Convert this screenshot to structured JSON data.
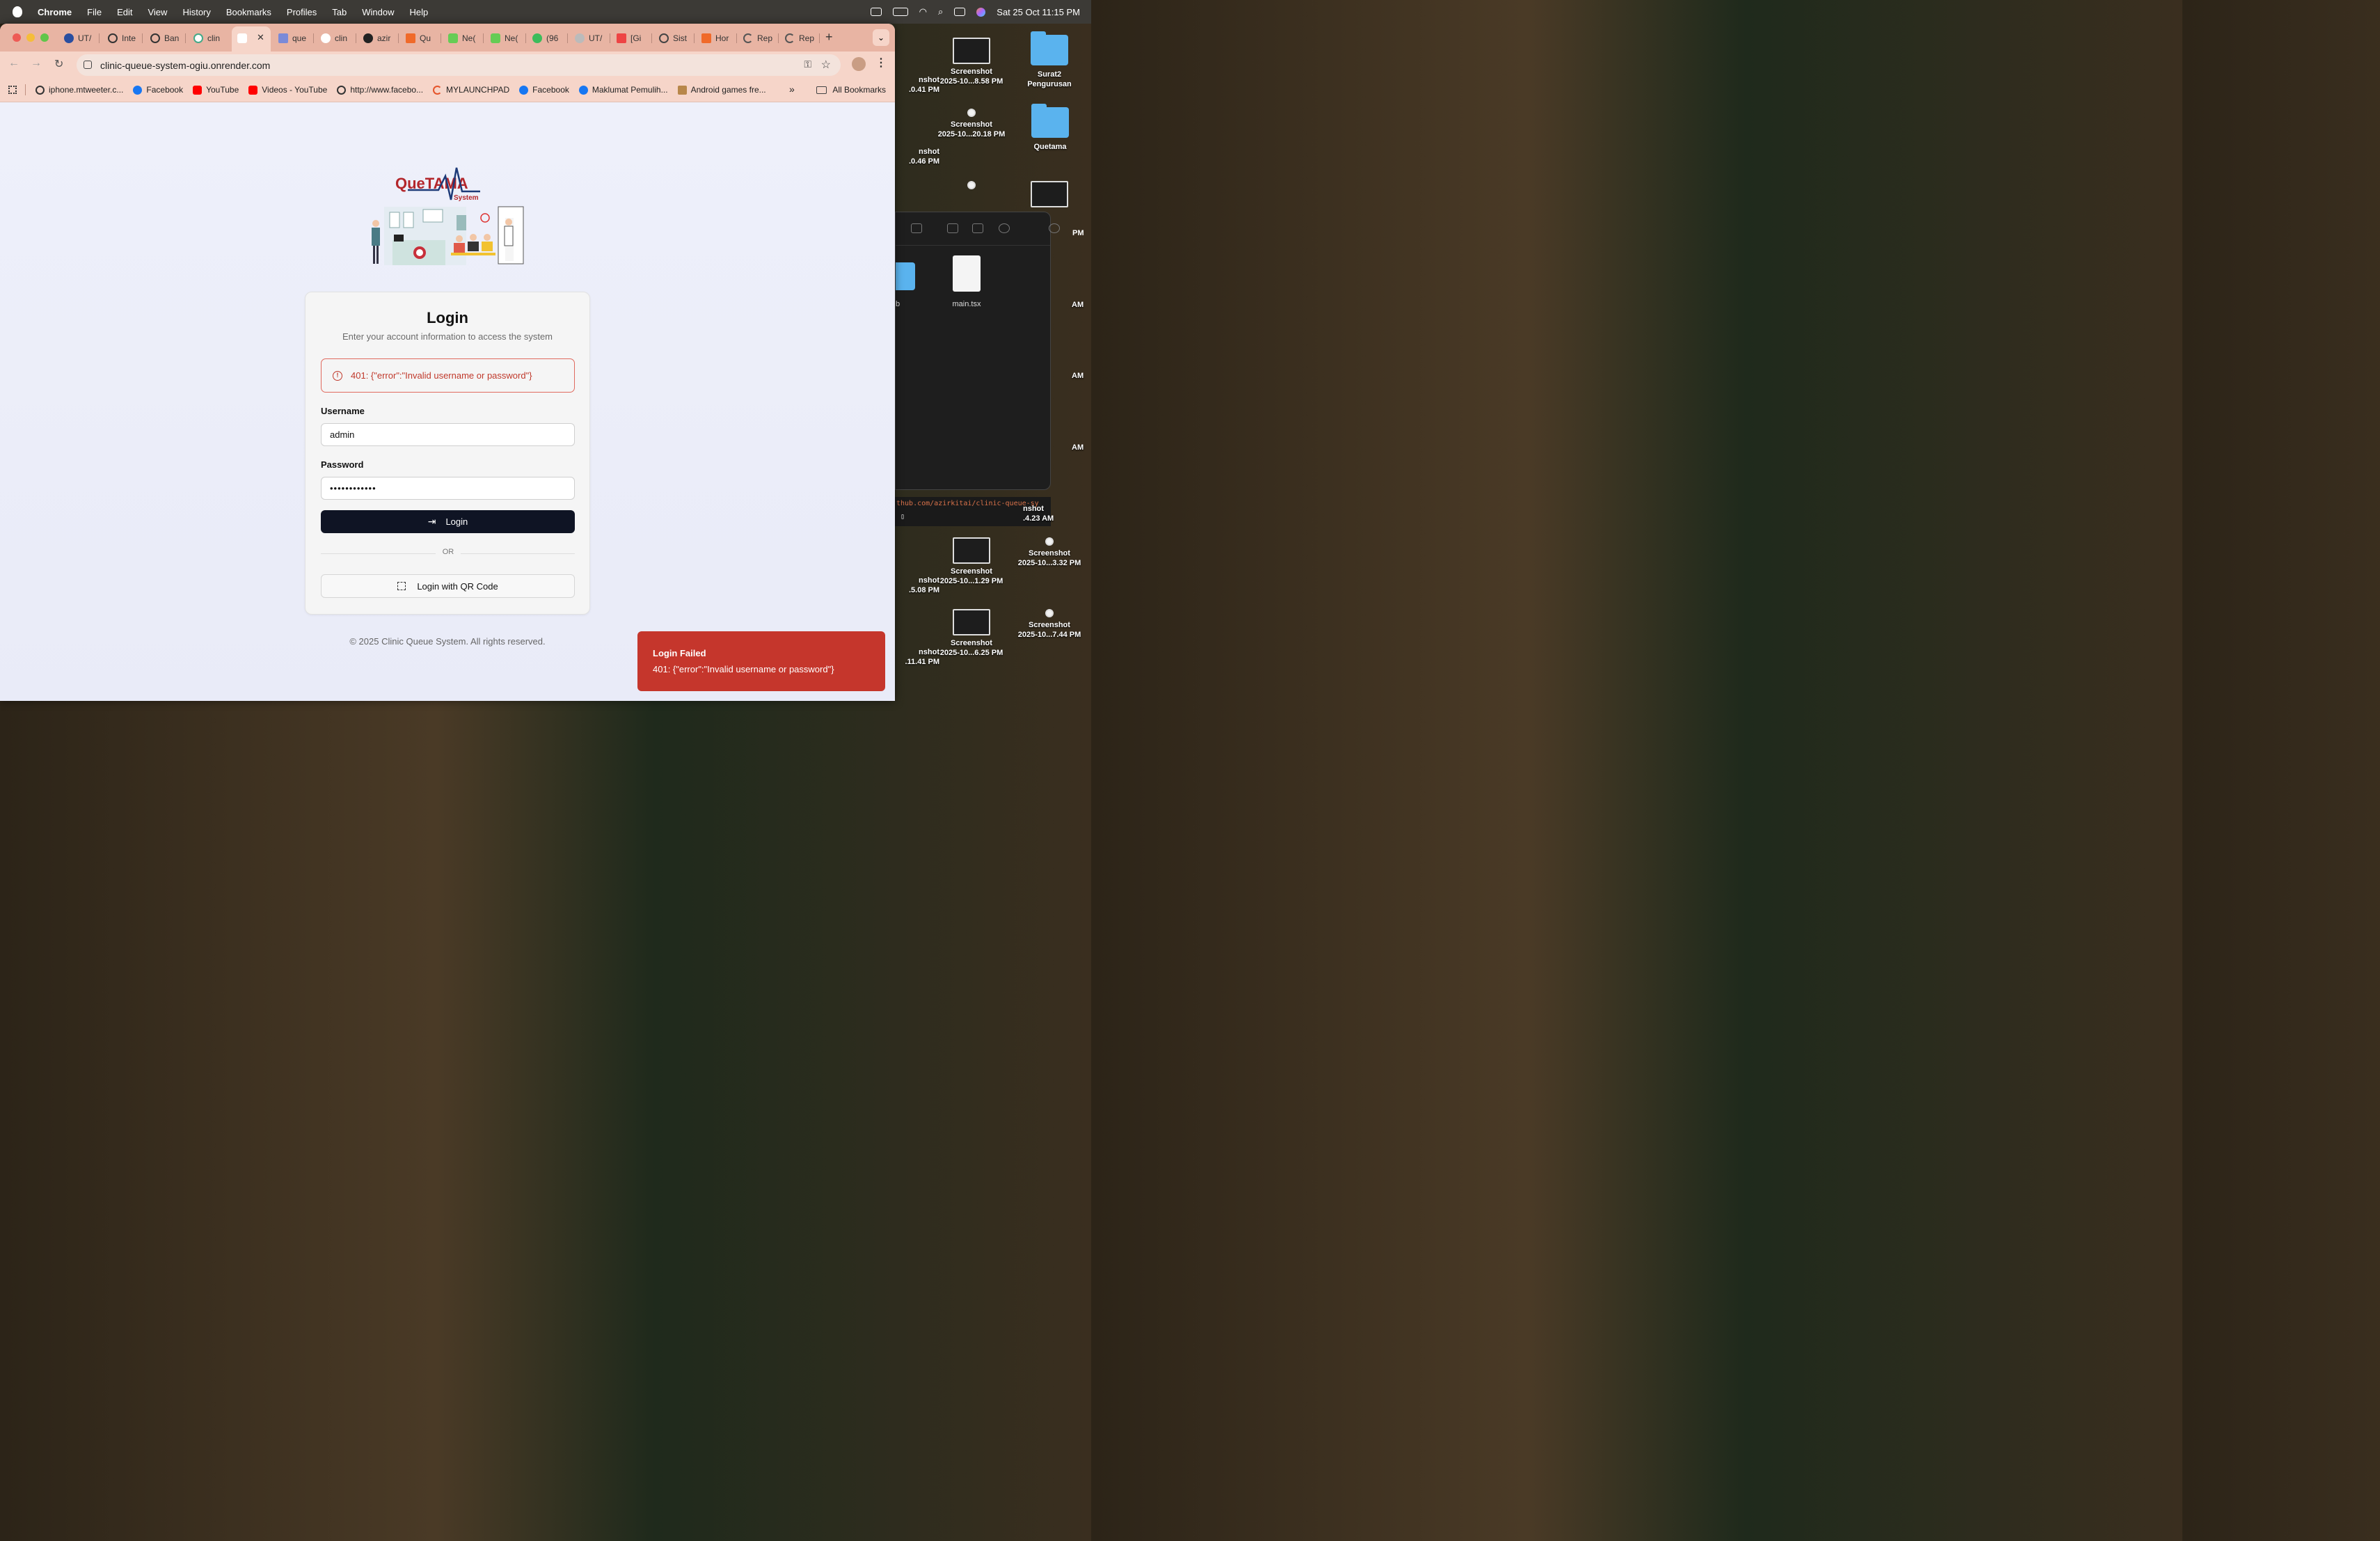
{
  "menubar": {
    "app": "Chrome",
    "items": [
      "File",
      "Edit",
      "View",
      "History",
      "Bookmarks",
      "Profiles",
      "Tab",
      "Window",
      "Help"
    ],
    "datetime": "Sat 25 Oct  11:15 PM"
  },
  "tabs": [
    {
      "label": "UT/"
    },
    {
      "label": "Inte"
    },
    {
      "label": "Ban"
    },
    {
      "label": "clin"
    },
    {
      "label": ""
    },
    {
      "label": "que"
    },
    {
      "label": "clin"
    },
    {
      "label": "azir"
    },
    {
      "label": "Qu"
    },
    {
      "label": "Ne("
    },
    {
      "label": "Ne("
    },
    {
      "label": "(96"
    },
    {
      "label": "UT/"
    },
    {
      "label": "[Gi"
    },
    {
      "label": "Sist"
    },
    {
      "label": "Hor"
    },
    {
      "label": "Rep"
    },
    {
      "label": "Rep"
    }
  ],
  "address_bar": {
    "url": "clinic-queue-system-ogiu.onrender.com"
  },
  "bookmarks": [
    {
      "label": "iphone.mtweeter.c..."
    },
    {
      "label": "Facebook"
    },
    {
      "label": "YouTube"
    },
    {
      "label": "Videos - YouTube"
    },
    {
      "label": "http://www.facebo..."
    },
    {
      "label": "MYLAUNCHPAD"
    },
    {
      "label": "Facebook"
    },
    {
      "label": "Maklumat Pemulih..."
    },
    {
      "label": "Android games fre..."
    }
  ],
  "all_bookmarks": "All Bookmarks",
  "logo": {
    "brand": "QueTAMA",
    "tag": "System"
  },
  "login": {
    "title": "Login",
    "subtitle": "Enter your account information to access the system",
    "error": "401: {\"error\":\"Invalid username or password\"}",
    "username_label": "Username",
    "username_value": "admin",
    "password_label": "Password",
    "password_value": "••••••••••••",
    "login_button": "Login",
    "or": "OR",
    "qr_button": "Login with QR Code"
  },
  "footer": "© 2025 Clinic Queue System. All rights reserved.",
  "toast": {
    "title": "Login Failed",
    "message": "401: {\"error\":\"Invalid username or password\"}"
  },
  "desktop": {
    "icons": [
      {
        "line1": "Screenshot",
        "line2": "2025-10...8.58 PM"
      },
      {
        "line1": "Surat2",
        "line2": "Pengurusan"
      },
      {
        "line1": "Screenshot",
        "line2": "2025-10...20.18 PM"
      },
      {
        "line1": "Quetama",
        "line2": ""
      },
      {
        "line1": "Screenshot",
        "line2": "2025-10...1.29 PM"
      },
      {
        "line1": "Screenshot",
        "line2": "2025-10...3.32 PM"
      },
      {
        "line1": "Screenshot",
        "line2": "2025-10...6.25 PM"
      },
      {
        "line1": "Screenshot",
        "line2": "2025-10...7.44 PM"
      }
    ],
    "edge_labels": [
      "nshot",
      ".0.41 PM",
      "nshot",
      ".0.46 PM",
      "nshot",
      ".5.08 PM",
      "nshot",
      ".11.41 PM"
    ],
    "right_edge": [
      "PM",
      "AM",
      "AM",
      "AM"
    ],
    "partial_shot": [
      "nshot",
      ".4.23 AM"
    ],
    "finder_file": "main.tsx",
    "finder_folder_edge": "b",
    "terminal_text": "thub.com/azirkitai/clinic-queue-sy"
  }
}
